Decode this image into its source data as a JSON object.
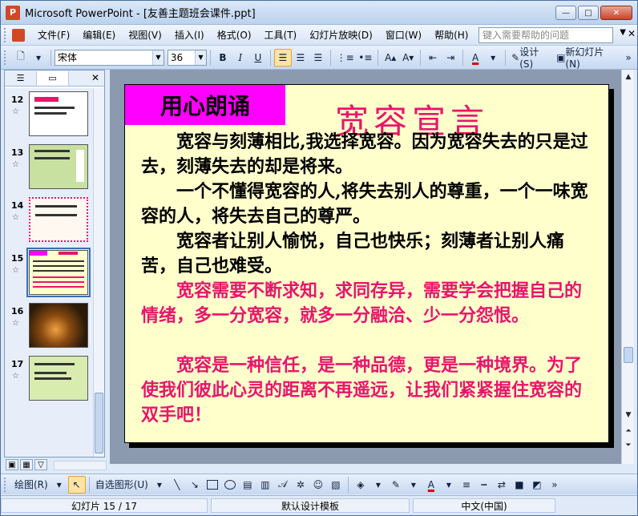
{
  "window": {
    "title": "Microsoft PowerPoint - [友善主题班会课件.ppt]",
    "minimize": "—",
    "maximize": "□",
    "close": "✕"
  },
  "menu": {
    "items": [
      "文件(F)",
      "编辑(E)",
      "视图(V)",
      "插入(I)",
      "格式(O)",
      "工具(T)",
      "幻灯片放映(D)",
      "窗口(W)",
      "帮助(H)"
    ],
    "help_placeholder": "键入需要帮助的问题"
  },
  "toolbar": {
    "font_name": "宋体",
    "font_size": "36",
    "bold": "B",
    "italic": "I",
    "underline": "U",
    "font_color": "A",
    "design": "设计(S)",
    "new_slide": "新幻灯片(N)"
  },
  "thumbnails": [
    {
      "num": "12",
      "bg": "#ffffff"
    },
    {
      "num": "13",
      "bg": "#c8e0a0"
    },
    {
      "num": "14",
      "bg": "#fff8f0"
    },
    {
      "num": "15",
      "bg": "#ffffcc"
    },
    {
      "num": "16",
      "bg": "#2a1a08"
    },
    {
      "num": "17",
      "bg": "#d8ecb0"
    }
  ],
  "slide": {
    "label": "用心朗诵",
    "title": "宽容宣言",
    "paragraphs": [
      {
        "text": "　　宽容与刻薄相比,我选择宽容。因为宽容失去的只是过去，刻薄失去的却是将来。",
        "color": "black"
      },
      {
        "text": "　　一个不懂得宽容的人,将失去别人的尊重，一个一味宽容的人，将失去自己的尊严。",
        "color": "black"
      },
      {
        "text": "　　宽容者让别人愉悦，自己也快乐；刻薄者让别人痛苦，自己也难受。",
        "color": "black"
      },
      {
        "text": "　　宽容需要不断求知，求同存异，需要学会把握自己的情绪，多一分宽容，就多一分融洽、少一分怨恨。",
        "color": "pink"
      },
      {
        "text": "　　宽容是一种信任，是一种品德，更是一种境界。为了使我们彼此心灵的距离不再遥远，让我们紧紧握住宽容的双手吧！",
        "color": "pink"
      }
    ]
  },
  "drawing": {
    "draw_label": "绘图(R)",
    "autoshapes_label": "自选图形(U)"
  },
  "status": {
    "slide_info": "幻灯片 15 / 17",
    "template": "默认设计模板",
    "language": "中文(中国)"
  },
  "colors": {
    "accent_pink": "#e8156b",
    "label_magenta": "#ff00ff",
    "slide_bg": "#ffffcc"
  }
}
